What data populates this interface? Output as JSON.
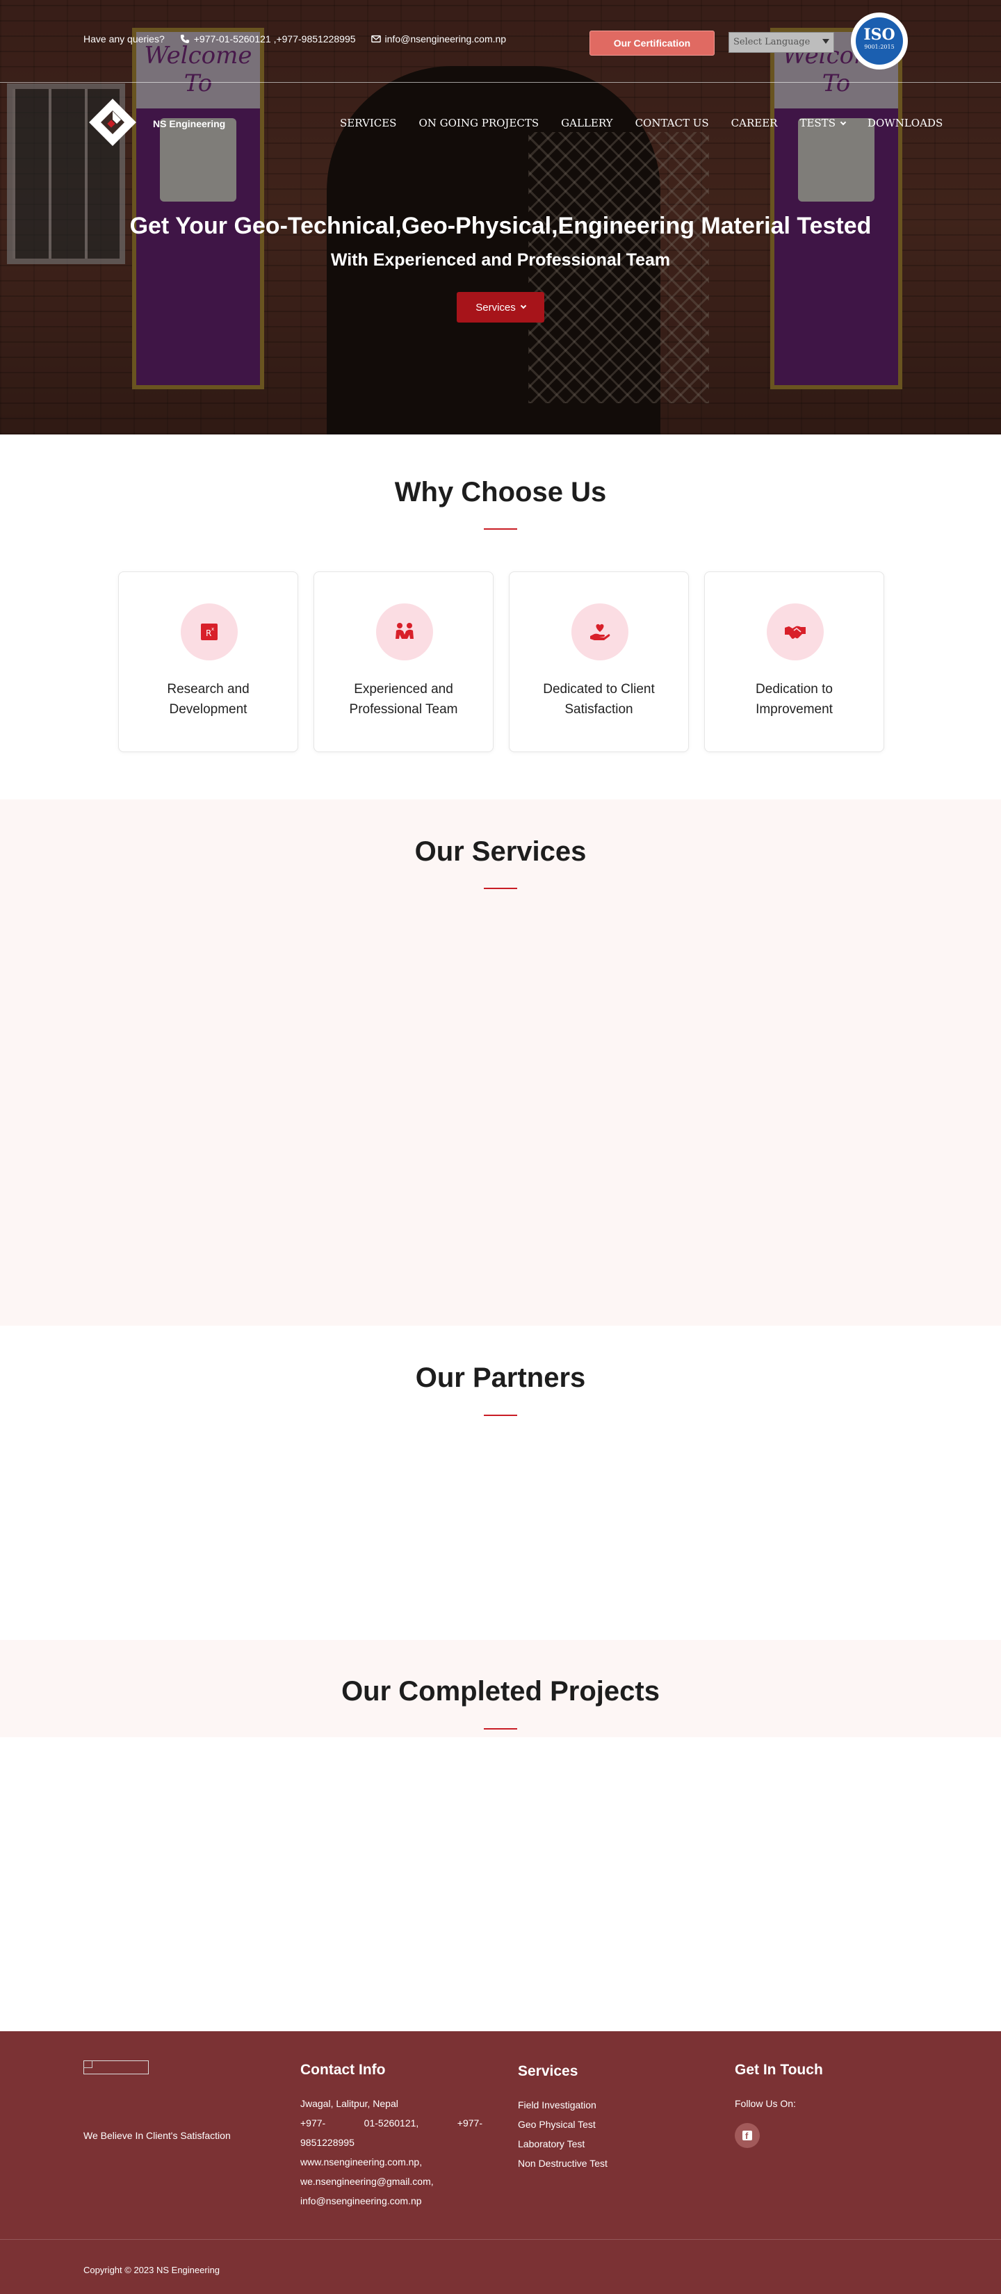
{
  "topbar": {
    "queries_label": "Have any queries?",
    "phone": "+977-01-5260121 ,+977-9851228995",
    "email": "info@nsengineering.com.np",
    "certification_button": "Our Certification",
    "language_select": "Select Language",
    "iso_badge": {
      "title": "ISO",
      "sub": "9001:2015"
    }
  },
  "brand": {
    "name": "NS Engineering"
  },
  "nav": {
    "items": [
      "SERVICES",
      "ON GOING PROJECTS",
      "GALLERY",
      "CONTACT US",
      "CAREER",
      "TESTS",
      "DOWNLOADS"
    ]
  },
  "hero": {
    "title": "Get Your Geo-Technical,Geo-Physical,Engineering Material Tested",
    "subtitle": "With Experienced and Professional Team",
    "button": "Services",
    "banner_heading": "Welcome To"
  },
  "why": {
    "title": "Why Choose Us",
    "cards": [
      {
        "label": "Research and Development",
        "icon": "research-icon"
      },
      {
        "label": "Experienced and Professional Team",
        "icon": "team-icon"
      },
      {
        "label": "Dedicated to Client Satisfaction",
        "icon": "heart-hand-icon"
      },
      {
        "label": "Dedication to Improvement",
        "icon": "handshake-icon"
      }
    ]
  },
  "services": {
    "title": "Our Services"
  },
  "partners": {
    "title": "Our Partners"
  },
  "projects": {
    "title": "Our Completed Projects"
  },
  "footer": {
    "tagline": "We Believe In Client's Satisfaction",
    "contact": {
      "title": "Contact Info",
      "address": "Jwagal, Lalitpur, Nepal",
      "phone_a": "+977-",
      "phone_b": "01-5260121,",
      "phone_c": "+977-",
      "phone_d": "9851228995",
      "website": "www.nsengineering.com.np,",
      "email1": "we.nsengineering@gmail.com,",
      "email2": "info@nsengineering.com.np"
    },
    "services": {
      "title": "Services",
      "items": [
        "Field Investigation",
        "Geo Physical Test",
        "Laboratory Test",
        "Non Destructive Test"
      ]
    },
    "touch": {
      "title": "Get In Touch",
      "follow": "Follow Us On:"
    },
    "copyright": "Copyright © 2023 NS Engineering"
  },
  "colors": {
    "accent": "#c91d25",
    "button_red": "#a7141a",
    "footer_bg": "#7b3234",
    "cert_btn": "#e06a62"
  }
}
